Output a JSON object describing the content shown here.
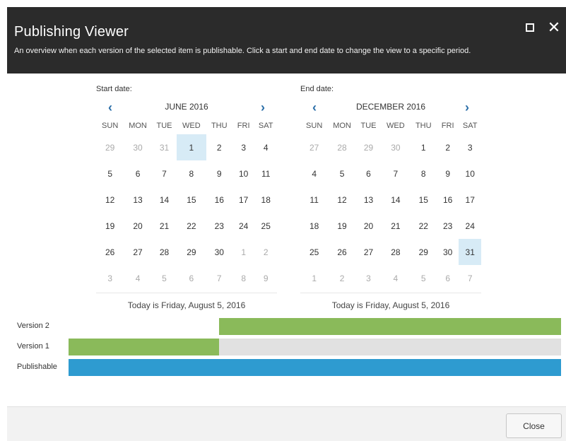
{
  "dialog": {
    "title": "Publishing Viewer",
    "description": "An overview when each version of the selected item is publishable. Click a start and end date to change the view to a specific period."
  },
  "start_calendar": {
    "label": "Start date:",
    "month": "JUNE 2016",
    "weekdays": [
      "SUN",
      "MON",
      "TUE",
      "WED",
      "THU",
      "FRI",
      "SAT"
    ],
    "weeks": [
      [
        "29",
        "30",
        "31",
        "1",
        "2",
        "3",
        "4"
      ],
      [
        "5",
        "6",
        "7",
        "8",
        "9",
        "10",
        "11"
      ],
      [
        "12",
        "13",
        "14",
        "15",
        "16",
        "17",
        "18"
      ],
      [
        "19",
        "20",
        "21",
        "22",
        "23",
        "24",
        "25"
      ],
      [
        "26",
        "27",
        "28",
        "29",
        "30",
        "1",
        "2"
      ],
      [
        "3",
        "4",
        "5",
        "6",
        "7",
        "8",
        "9"
      ]
    ],
    "selected": "1",
    "today_text": "Today is Friday, August 5, 2016"
  },
  "end_calendar": {
    "label": "End date:",
    "month": "DECEMBER 2016",
    "weekdays": [
      "SUN",
      "MON",
      "TUE",
      "WED",
      "THU",
      "FRI",
      "SAT"
    ],
    "weeks": [
      [
        "27",
        "28",
        "29",
        "30",
        "1",
        "2",
        "3"
      ],
      [
        "4",
        "5",
        "6",
        "7",
        "8",
        "9",
        "10"
      ],
      [
        "11",
        "12",
        "13",
        "14",
        "15",
        "16",
        "17"
      ],
      [
        "18",
        "19",
        "20",
        "21",
        "22",
        "23",
        "24"
      ],
      [
        "25",
        "26",
        "27",
        "28",
        "29",
        "30",
        "31"
      ],
      [
        "1",
        "2",
        "3",
        "4",
        "5",
        "6",
        "7"
      ]
    ],
    "selected": "31",
    "today_text": "Today is Friday, August 5, 2016"
  },
  "timeline": {
    "rows": [
      {
        "label": "Version 2",
        "segments": [
          {
            "from": 0.305,
            "to": 1.0,
            "color": "#8aba5a"
          }
        ]
      },
      {
        "label": "Version 1",
        "segments": [
          {
            "from": 0.0,
            "to": 0.305,
            "color": "#8aba5a"
          },
          {
            "from": 0.305,
            "to": 1.0,
            "color": "#e1e1e1"
          }
        ]
      },
      {
        "label": "Publishable",
        "segments": [
          {
            "from": 0.0,
            "to": 1.0,
            "color": "#2e9bd0"
          }
        ]
      }
    ]
  },
  "footer": {
    "close_label": "Close"
  },
  "colors": {
    "header_bg": "#2b2b2b",
    "accent_nav": "#2a6ea8",
    "selected_day": "#d7ebf6",
    "green": "#8aba5a",
    "blue": "#2e9bd0",
    "gray": "#e1e1e1"
  },
  "icons": {
    "maximize": "maximize-icon",
    "close": "close-icon",
    "prev": "chevron-left-icon",
    "next": "chevron-right-icon"
  }
}
